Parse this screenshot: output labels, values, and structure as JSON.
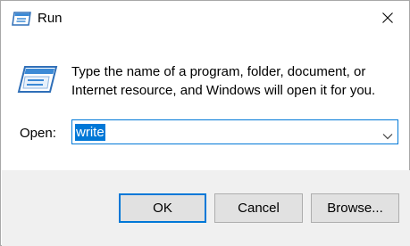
{
  "window": {
    "title": "Run",
    "title_icon": "run-icon",
    "close_icon": "close-icon"
  },
  "body": {
    "icon": "run-program-icon",
    "message_line1": "Type the name of a program, folder, document, or",
    "message_line2": "Internet resource, and Windows will open it for you."
  },
  "open_field": {
    "label": "Open:",
    "value": "write",
    "value_selected": true,
    "dropdown_icon": "chevron-down-icon"
  },
  "buttons": {
    "ok": "OK",
    "cancel": "Cancel",
    "browse": "Browse..."
  },
  "colors": {
    "accent": "#0078d7",
    "footer_bg": "#f0f0f0",
    "button_bg": "#e1e1e1"
  }
}
